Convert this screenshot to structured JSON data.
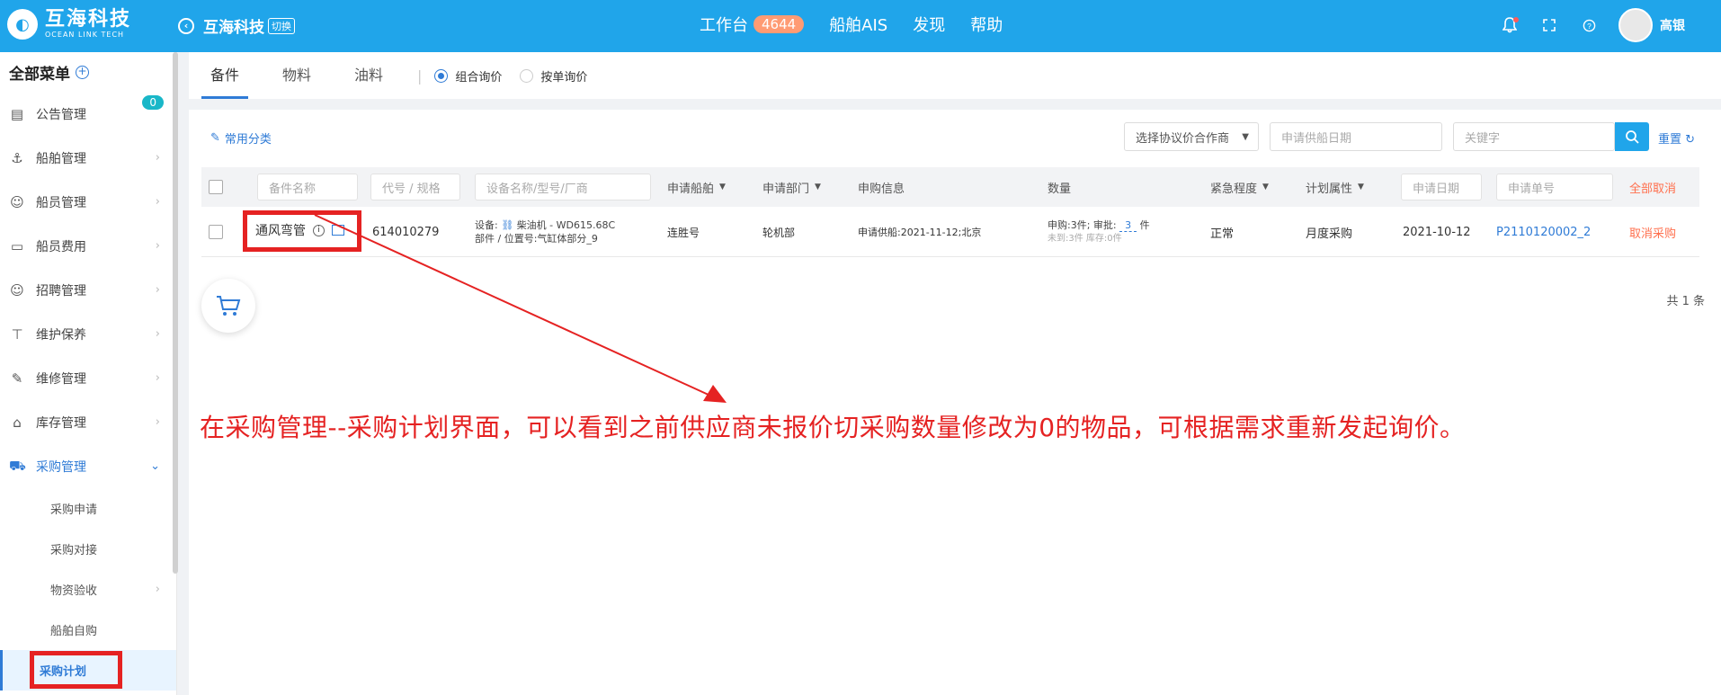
{
  "topbar": {
    "logo_cn": "互海科技",
    "logo_en": "OCEAN LINK TECH",
    "company": "互海科技",
    "switch": "切换",
    "nav": [
      {
        "label": "工作台",
        "badge": "4644"
      },
      {
        "label": "船舶AIS"
      },
      {
        "label": "发现"
      },
      {
        "label": "帮助"
      }
    ],
    "user": "高银"
  },
  "sidebar": {
    "title": "全部菜单",
    "items": [
      {
        "label": "公告管理",
        "icon": "book-icon",
        "badge": "0"
      },
      {
        "label": "船舶管理",
        "icon": "anchor-icon"
      },
      {
        "label": "船员管理",
        "icon": "person-icon"
      },
      {
        "label": "船员费用",
        "icon": "wallet-icon"
      },
      {
        "label": "招聘管理",
        "icon": "recruit-icon"
      },
      {
        "label": "维护保养",
        "icon": "maintenance-icon"
      },
      {
        "label": "维修管理",
        "icon": "wrench-icon"
      },
      {
        "label": "库存管理",
        "icon": "warehouse-icon"
      },
      {
        "label": "采购管理",
        "icon": "cart-icon"
      }
    ],
    "sub_items": [
      {
        "label": "采购申请"
      },
      {
        "label": "采购对接"
      },
      {
        "label": "物资验收"
      },
      {
        "label": "船舶自购"
      },
      {
        "label": "采购计划"
      }
    ]
  },
  "tabs": {
    "items": [
      "备件",
      "物料",
      "油料"
    ],
    "radios": [
      "组合询价",
      "按单询价"
    ]
  },
  "filters": {
    "common_category": "常用分类",
    "agreement_select": "选择协议价合作商",
    "supply_date": "申请供船日期",
    "keyword": "关键字",
    "reset": "重置"
  },
  "table": {
    "headers": {
      "part_name": "备件名称",
      "code": "代号 / 规格",
      "equipment": "设备名称/型号/厂商",
      "ship": "申请船舶",
      "dept": "申请部门",
      "info": "申购信息",
      "qty": "数量",
      "urgency": "紧急程度",
      "plan": "计划属性",
      "apply_date": "申请日期",
      "apply_no": "申请单号",
      "cancel_all": "全部取消"
    },
    "rows": [
      {
        "name": "通风弯管",
        "code": "614010279",
        "equip_line1_label": "设备:",
        "equip_line1_value": "柴油机 - WD615.68C",
        "equip_line2": "部件 / 位置号:气缸体部分_9",
        "ship": "连胜号",
        "dept": "轮机部",
        "info": "申请供船:2021-11-12;北京",
        "qty_line1": "申购:3件; 审批:",
        "qty_approved": "3",
        "qty_unit": "件",
        "qty_line2": "未到:3件 库存:0件",
        "urgency": "正常",
        "plan": "月度采购",
        "date": "2021-10-12",
        "no": "P2110120002_2",
        "action": "取消采购"
      }
    ],
    "total": "共 1 条"
  },
  "annotation": "在采购管理--采购计划界面，可以看到之前供应商未报价切采购数量修改为0的物品，可根据需求重新发起询价。"
}
